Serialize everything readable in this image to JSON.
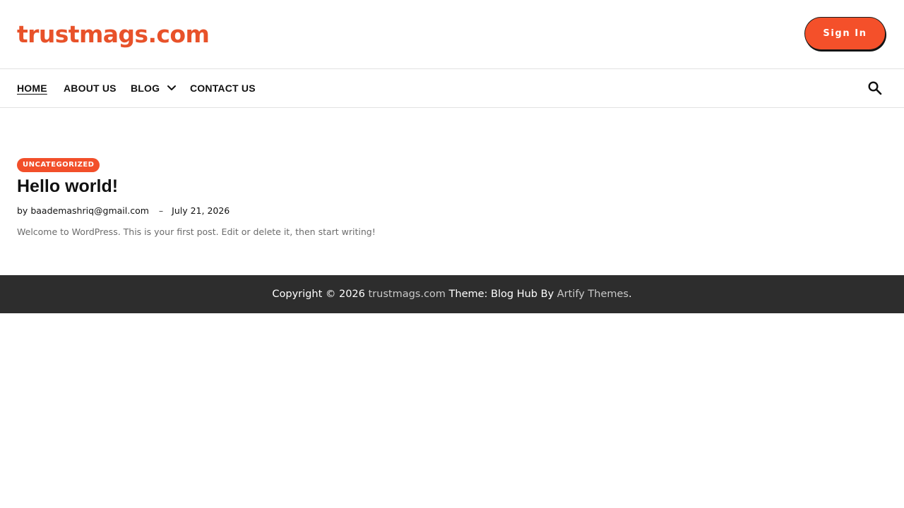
{
  "header": {
    "site_title": "trustmags.com",
    "sign_in_label": "Sign In"
  },
  "nav": {
    "items": [
      {
        "label": "HOME"
      },
      {
        "label": "ABOUT US"
      },
      {
        "label": "BLOG"
      },
      {
        "label": "CONTACT US"
      }
    ],
    "search_icon": "search-icon",
    "blog_dropdown_icon": "chevron-down-icon"
  },
  "post": {
    "category": "UNCATEGORIZED",
    "title": "Hello world!",
    "by_prefix": "by",
    "author": "baademashriq@gmail.com",
    "separator": "–",
    "date": "July 21, 2026",
    "excerpt": "Welcome to WordPress. This is your first post. Edit or delete it, then start writing!"
  },
  "footer": {
    "copyright": "Copyright © 2026",
    "site_link": "trustmags.com",
    "theme_text": "Theme: Blog Hub By",
    "theme_author": "Artify Themes",
    "end_period": "."
  },
  "colors": {
    "accent": "#f4502a",
    "title": "#e8522a",
    "footer_bg": "#2d2d2d"
  }
}
